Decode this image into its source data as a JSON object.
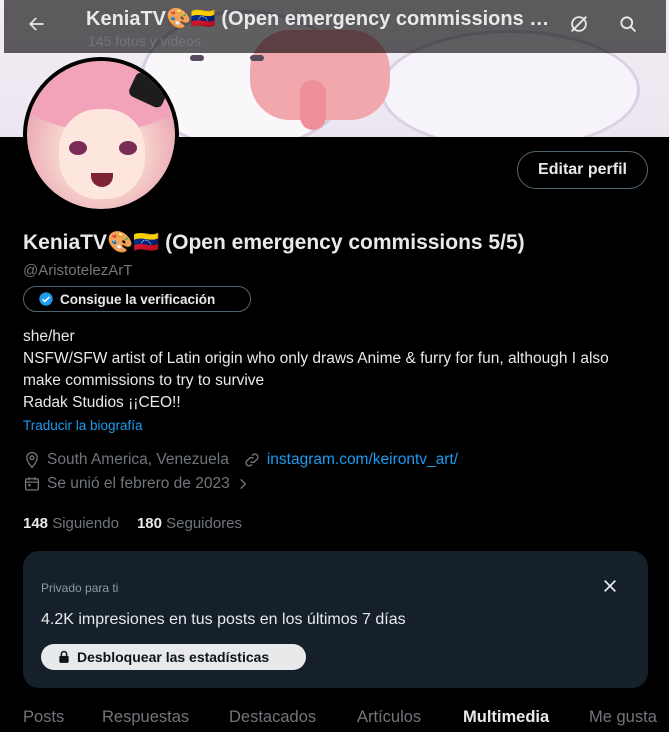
{
  "header": {
    "title": "KeniaTV🎨🇻🇪 (Open emergency commissions 5/5)",
    "subtitle": "145 fotos y videos",
    "back_icon": "arrow-left-icon",
    "hide_icon": "slashed-circle-icon",
    "search_icon": "search-icon"
  },
  "profile": {
    "edit_label": "Editar perfil",
    "name": "KeniaTV🎨🇻🇪 (Open emergency commissions 5/5)",
    "handle": "@AristotelezArT",
    "verify_label": "Consigue la verificación",
    "bio_lines": [
      "she/her",
      "NSFW/SFW artist of Latin origin who only draws Anime & furry for fun, although I also make commissions to try to survive",
      "Radak Studios ¡¡CEO!!"
    ],
    "translate_label": "Traducir la biografía",
    "location": "South America, Venezuela",
    "website": "instagram.com/keirontv_art/",
    "joined": "Se unió el febrero de 2023",
    "following_count": "148",
    "following_label": "Siguiendo",
    "followers_count": "180",
    "followers_label": "Seguidores"
  },
  "insights": {
    "private_label": "Privado para ti",
    "impressions_text": "4.2K impresiones en tus posts en los últimos 7 días",
    "unlock_label": "Desbloquear las estadísticas"
  },
  "tabs": [
    {
      "label": "Posts"
    },
    {
      "label": "Respuestas"
    },
    {
      "label": "Destacados"
    },
    {
      "label": "Artículos"
    },
    {
      "label": "Multimedia",
      "active": true
    },
    {
      "label": "Me gusta"
    }
  ],
  "colors": {
    "background": "#000000",
    "accent": "#1d9bf0",
    "card": "#15202b",
    "muted": "#71767b"
  }
}
